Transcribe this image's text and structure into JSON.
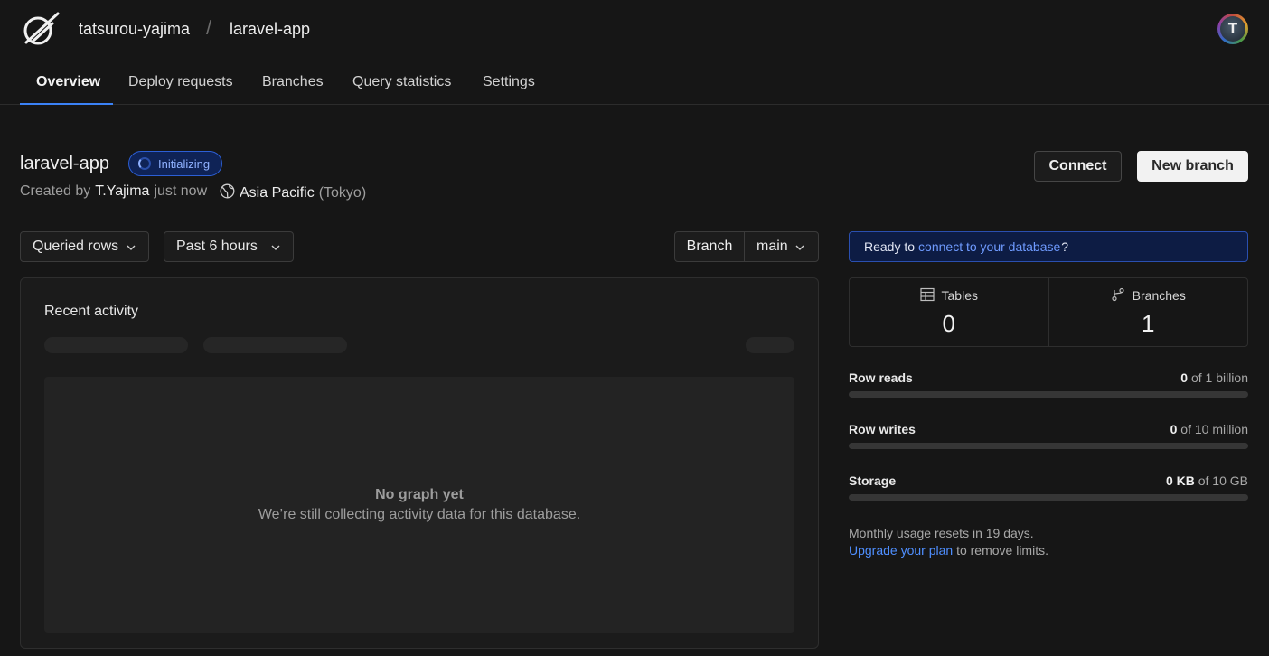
{
  "header": {
    "org": "tatsurou-yajima",
    "separator": "/",
    "database": "laravel-app",
    "avatar_letter": "T"
  },
  "tabs": [
    {
      "label": "Overview",
      "active": true
    },
    {
      "label": "Deploy requests",
      "active": false
    },
    {
      "label": "Branches",
      "active": false
    },
    {
      "label": "Query statistics",
      "active": false
    },
    {
      "label": "Settings",
      "active": false
    }
  ],
  "database": {
    "title": "laravel-app",
    "status": "Initializing",
    "created_prefix": "Created by",
    "created_by": "T.Yajima",
    "created_when": "just now",
    "region_name": "Asia Pacific",
    "region_city": "(Tokyo)"
  },
  "actions": {
    "connect": "Connect",
    "new_branch": "New branch"
  },
  "filters": {
    "metric": "Queried rows",
    "range": "Past 6 hours",
    "branch_label": "Branch",
    "branch_value": "main"
  },
  "activity": {
    "title": "Recent activity",
    "empty_title": "No graph yet",
    "empty_sub": "We’re still collecting activity data for this database."
  },
  "ready": {
    "prefix": "Ready to",
    "link": "connect to your database",
    "suffix": "?"
  },
  "stats": {
    "tables_label": "Tables",
    "tables_value": "0",
    "branches_label": "Branches",
    "branches_value": "1"
  },
  "usage": [
    {
      "label": "Row reads",
      "used": "0",
      "limit": "of 1 billion",
      "fraction": 0
    },
    {
      "label": "Row writes",
      "used": "0",
      "limit": "of 10 million",
      "fraction": 0
    },
    {
      "label": "Storage",
      "used": "0 KB",
      "limit": "of 10 GB",
      "fraction": 0
    }
  ],
  "note": {
    "reset": "Monthly usage resets in 19 days.",
    "upgrade_link": "Upgrade your plan",
    "upgrade_suffix": "to remove limits."
  },
  "colors": {
    "accent": "#3b82f6",
    "background": "#161616"
  }
}
